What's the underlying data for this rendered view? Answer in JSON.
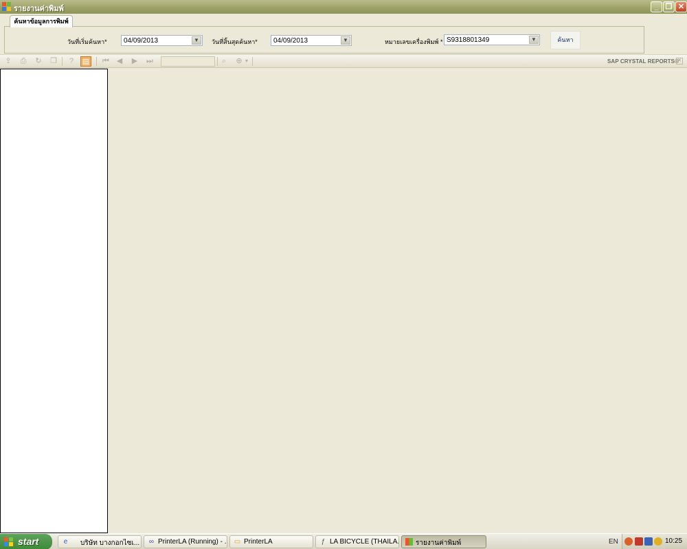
{
  "window": {
    "title": "รายงานค่าพิมพ์"
  },
  "search_group": {
    "tab_label": "ค้นหาข้อมูลการพิมพ์",
    "start_date": {
      "label": "วันที่เริ่มค้นหา*",
      "value": "04/09/2013"
    },
    "end_date": {
      "label": "วันที่สิ้นสุดค้นหา*",
      "value": "04/09/2013"
    },
    "printer_no": {
      "label": "หมายเลขเครื่องพิมพ์ *",
      "value": "S9318801349"
    },
    "search_button": "ค้นหา"
  },
  "report_toolbar": {
    "brand": "SAP CRYSTAL REPORTS®",
    "goto_page_value": ""
  },
  "taskbar": {
    "start_label": "start",
    "buttons": [
      {
        "label": "บริษัท บางกอกไซเ...",
        "icon": "ie-icon"
      },
      {
        "label": "PrinterLA (Running) - ...",
        "icon": "vs-icon"
      },
      {
        "label": "PrinterLA",
        "icon": "folder-icon"
      },
      {
        "label": "LA BICYCLE (THAILA...",
        "icon": "app-icon"
      },
      {
        "label": "รายงานค่าพิมพ์",
        "icon": "form-icon"
      }
    ],
    "language": "EN",
    "clock": "10:25"
  }
}
